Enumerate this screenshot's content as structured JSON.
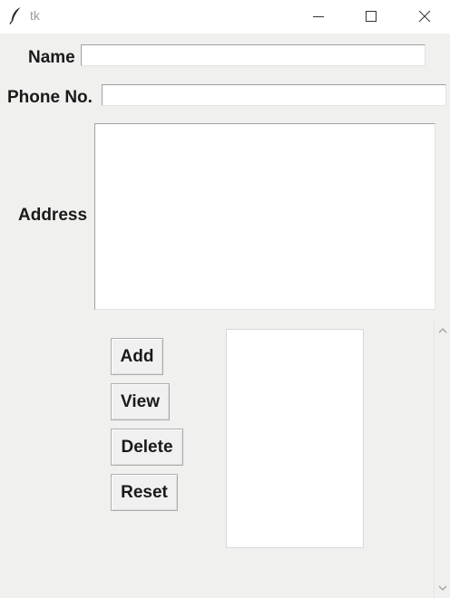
{
  "window": {
    "title": "tk",
    "icons": {
      "app": "feather-icon",
      "minimize": "minimize-icon",
      "maximize": "maximize-icon",
      "close": "close-icon"
    }
  },
  "form": {
    "name_label": "Name",
    "name_value": "",
    "phone_label": "Phone No.",
    "phone_value": "",
    "address_label": "Address",
    "address_value": ""
  },
  "buttons": {
    "add": "Add",
    "view": "View",
    "delete": "Delete",
    "reset": "Reset"
  },
  "listbox": {
    "items": []
  },
  "scrollbar": {
    "icons": {
      "up": "chevron-up-icon",
      "down": "chevron-down-icon"
    }
  }
}
